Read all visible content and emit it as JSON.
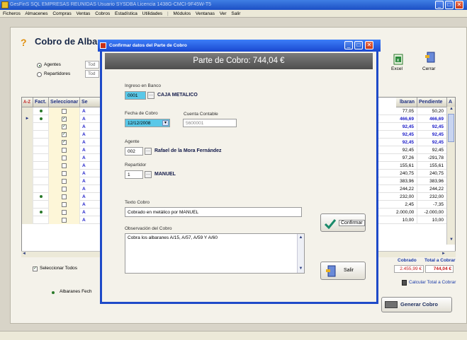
{
  "main_window": {
    "title": "GesFinS SQL EMPRESAS REUNIDAS   Usuario SYSDBA   Licencia 1438G-CMCI-9F45W-T5",
    "menu": [
      "Ficheros",
      "Almacenes",
      "Compras",
      "Ventas",
      "Cobros",
      "Estadística",
      "Utilidades",
      "|",
      "Módulos",
      "Ventanas",
      "Ver",
      "Salir"
    ]
  },
  "form": {
    "title": "Cobro de Albaranes",
    "radio_agentes": "Agentes",
    "radio_repartidores": "Repartidores",
    "filter_agentes_value": "Tod",
    "filter_repartidores_value": "Tod",
    "excel_label": "Excel",
    "cerrar_label": "Cerrar",
    "seleccionar_todos": "Seleccionar Todos",
    "albaranes_fecha": "Albaranes Fech",
    "cobrado_label": "Cobrado",
    "total_cobrar_label": "Total a Cobrar",
    "cobrado_value": "2.455,99 €",
    "total_cobrar_value": "744,04 €",
    "calcular_label": "Calcular Total a Cobrar",
    "generar_label": "Generar Cobro"
  },
  "grid": {
    "sort_label": "A-Z",
    "headers": {
      "fact": "Fact.",
      "sel": "Seleccionar",
      "se": "Se",
      "albaran": "lbaran",
      "pendiente": "Pendiente",
      "a": "A"
    },
    "rows": [
      {
        "fact": true,
        "checked": false,
        "se": "A",
        "alb": "77,05",
        "pend": "50,20",
        "blue": false,
        "current": false
      },
      {
        "fact": true,
        "checked": true,
        "se": "A",
        "alb": "466,69",
        "pend": "466,69",
        "blue": true,
        "current": true
      },
      {
        "fact": false,
        "checked": true,
        "se": "A",
        "alb": "92,45",
        "pend": "92,45",
        "blue": true,
        "current": false
      },
      {
        "fact": false,
        "checked": true,
        "se": "A",
        "alb": "92,45",
        "pend": "92,45",
        "blue": true,
        "current": false
      },
      {
        "fact": false,
        "checked": true,
        "se": "A",
        "alb": "92,45",
        "pend": "92,45",
        "blue": true,
        "current": false
      },
      {
        "fact": false,
        "checked": false,
        "se": "A",
        "alb": "92,45",
        "pend": "92,45",
        "blue": false,
        "current": false
      },
      {
        "fact": false,
        "checked": false,
        "se": "A",
        "alb": "97,26",
        "pend": "-291,78",
        "blue": false,
        "current": false
      },
      {
        "fact": false,
        "checked": false,
        "se": "A",
        "alb": "155,61",
        "pend": "155,61",
        "blue": false,
        "current": false
      },
      {
        "fact": false,
        "checked": false,
        "se": "A",
        "alb": "240,75",
        "pend": "240,75",
        "blue": false,
        "current": false
      },
      {
        "fact": false,
        "checked": false,
        "se": "A",
        "alb": "383,96",
        "pend": "383,96",
        "blue": false,
        "current": false
      },
      {
        "fact": false,
        "checked": false,
        "se": "A",
        "alb": "244,22",
        "pend": "244,22",
        "blue": false,
        "current": false
      },
      {
        "fact": true,
        "checked": false,
        "se": "A",
        "alb": "232,00",
        "pend": "232,00",
        "blue": false,
        "current": false
      },
      {
        "fact": false,
        "checked": false,
        "se": "A",
        "alb": "2,45",
        "pend": "-7,35",
        "blue": false,
        "current": false
      },
      {
        "fact": true,
        "checked": false,
        "se": "A",
        "alb": "2.000,00",
        "pend": "-2.000,00",
        "blue": false,
        "current": false
      },
      {
        "fact": false,
        "checked": false,
        "se": "A",
        "alb": "10,00",
        "pend": "10,00",
        "blue": false,
        "current": false
      }
    ]
  },
  "dialog": {
    "title": "Confirmar datos del Parte de Cobro",
    "header": "Parte de Cobro: 744,04 €",
    "ingreso_label": "Ingreso en Banco",
    "banco_code": "0001",
    "banco_name": "CAJA METALICO",
    "fecha_label": "Fecha de Cobro",
    "fecha_value": "12/12/2008",
    "cuenta_label": "Cuenta Contable",
    "cuenta_value": "5600001",
    "agente_label": "Agente",
    "agente_code": "002",
    "agente_name": "Rafael de la Mora Fernández",
    "repartidor_label": "Repartidor",
    "repartidor_code": "1",
    "repartidor_name": "MANUEL",
    "texto_label": "Texto Cobro",
    "texto_value": "Cobrado en metálico por MANUEL",
    "obs_label": "Observación del Cobro",
    "obs_value": "Cobra los albaranes A/15, A/57, A/59 Y A/60",
    "confirmar_label": "Confirmar",
    "salir_label": "Salir"
  },
  "icons": {
    "dots_glyph": "···",
    "dropdown_glyph": "▾",
    "scroll_up": "▲",
    "scroll_down": "▼",
    "scroll_left": "◄",
    "scroll_right": "►",
    "min": "_",
    "max": "□",
    "close": "✕",
    "row_pointer": "►"
  },
  "colors": {
    "accent": "#1e4ac8",
    "field_highlight": "#5ac8e8",
    "total_blue": "#1a1ac8",
    "total_red": "#c81a1a"
  }
}
